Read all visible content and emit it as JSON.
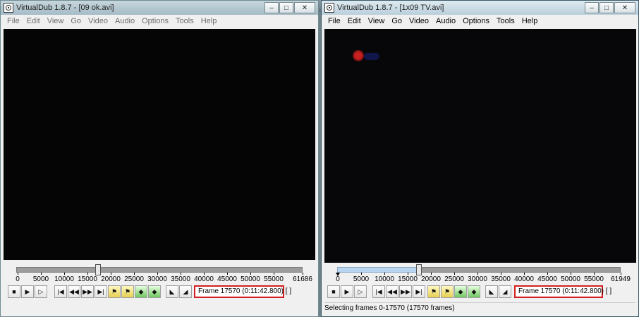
{
  "left": {
    "title": "VirtualDub 1.8.7 - [09 ok.avi]",
    "menu": [
      "File",
      "Edit",
      "View",
      "Go",
      "Video",
      "Audio",
      "Options",
      "Tools",
      "Help"
    ],
    "ticks": [
      "0",
      "5000",
      "10000",
      "15000",
      "20000",
      "25000",
      "30000",
      "35000",
      "40000",
      "45000",
      "50000",
      "55000",
      "61686"
    ],
    "frame_info": "Frame 17570 (0:11:42.800) [ ]"
  },
  "right": {
    "title": "VirtualDub 1.8.7 - [1x09 TV.avi]",
    "menu": [
      "File",
      "Edit",
      "View",
      "Go",
      "Video",
      "Audio",
      "Options",
      "Tools",
      "Help"
    ],
    "ticks": [
      "0",
      "5000",
      "10000",
      "15000",
      "20000",
      "25000",
      "30000",
      "35000",
      "40000",
      "45000",
      "50000",
      "55000",
      "61949"
    ],
    "frame_info": "Frame 17570 (0:11:42.800) [ ]",
    "status": "Selecting frames 0-17570 (17570 frames)"
  },
  "caption": {
    "minimize": "–",
    "maximize": "□",
    "close": "✕"
  },
  "icons": {
    "app": "virtualdub-film-icon",
    "toolbar": [
      "stop",
      "play-input",
      "play-output",
      "start",
      "prev",
      "next",
      "end",
      "prev-key",
      "next-key",
      "scene-back",
      "scene-fwd",
      "mark-in",
      "mark-out"
    ]
  },
  "colors": {
    "highlight_box": "#d42020",
    "video_bg": "#050505"
  }
}
